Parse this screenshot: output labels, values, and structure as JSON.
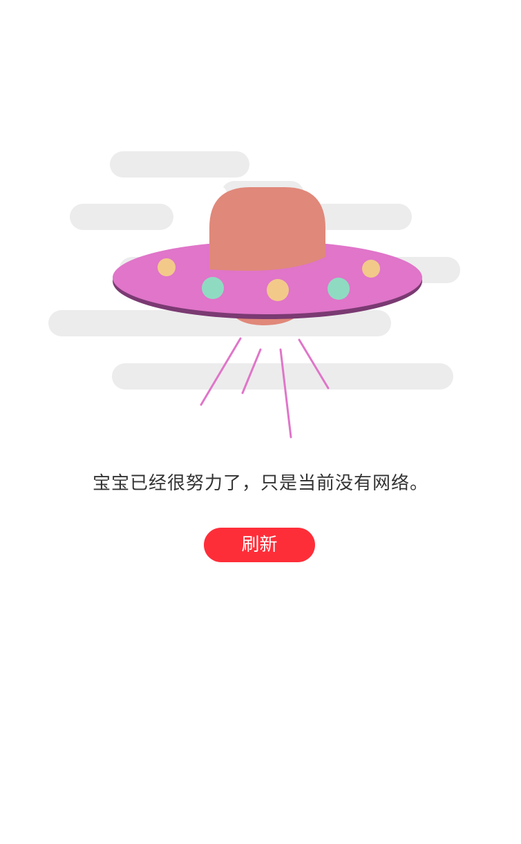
{
  "empty_state": {
    "illustration_icon": "ufo-icon",
    "message": "宝宝已经很努力了，只是当前没有网络。",
    "refresh_label": "刷新"
  },
  "colors": {
    "background": "#ffffff",
    "cloud": "#ececec",
    "ufo_body": "#e075c9",
    "ufo_rim_shadow": "#7a3a72",
    "ufo_dome": "#e0887a",
    "light_yellow": "#f3c98a",
    "light_teal": "#8fdbc2",
    "beam": "#e075c9",
    "button": "#fe2e39",
    "button_text": "#ffffff",
    "message_text": "#333333"
  }
}
